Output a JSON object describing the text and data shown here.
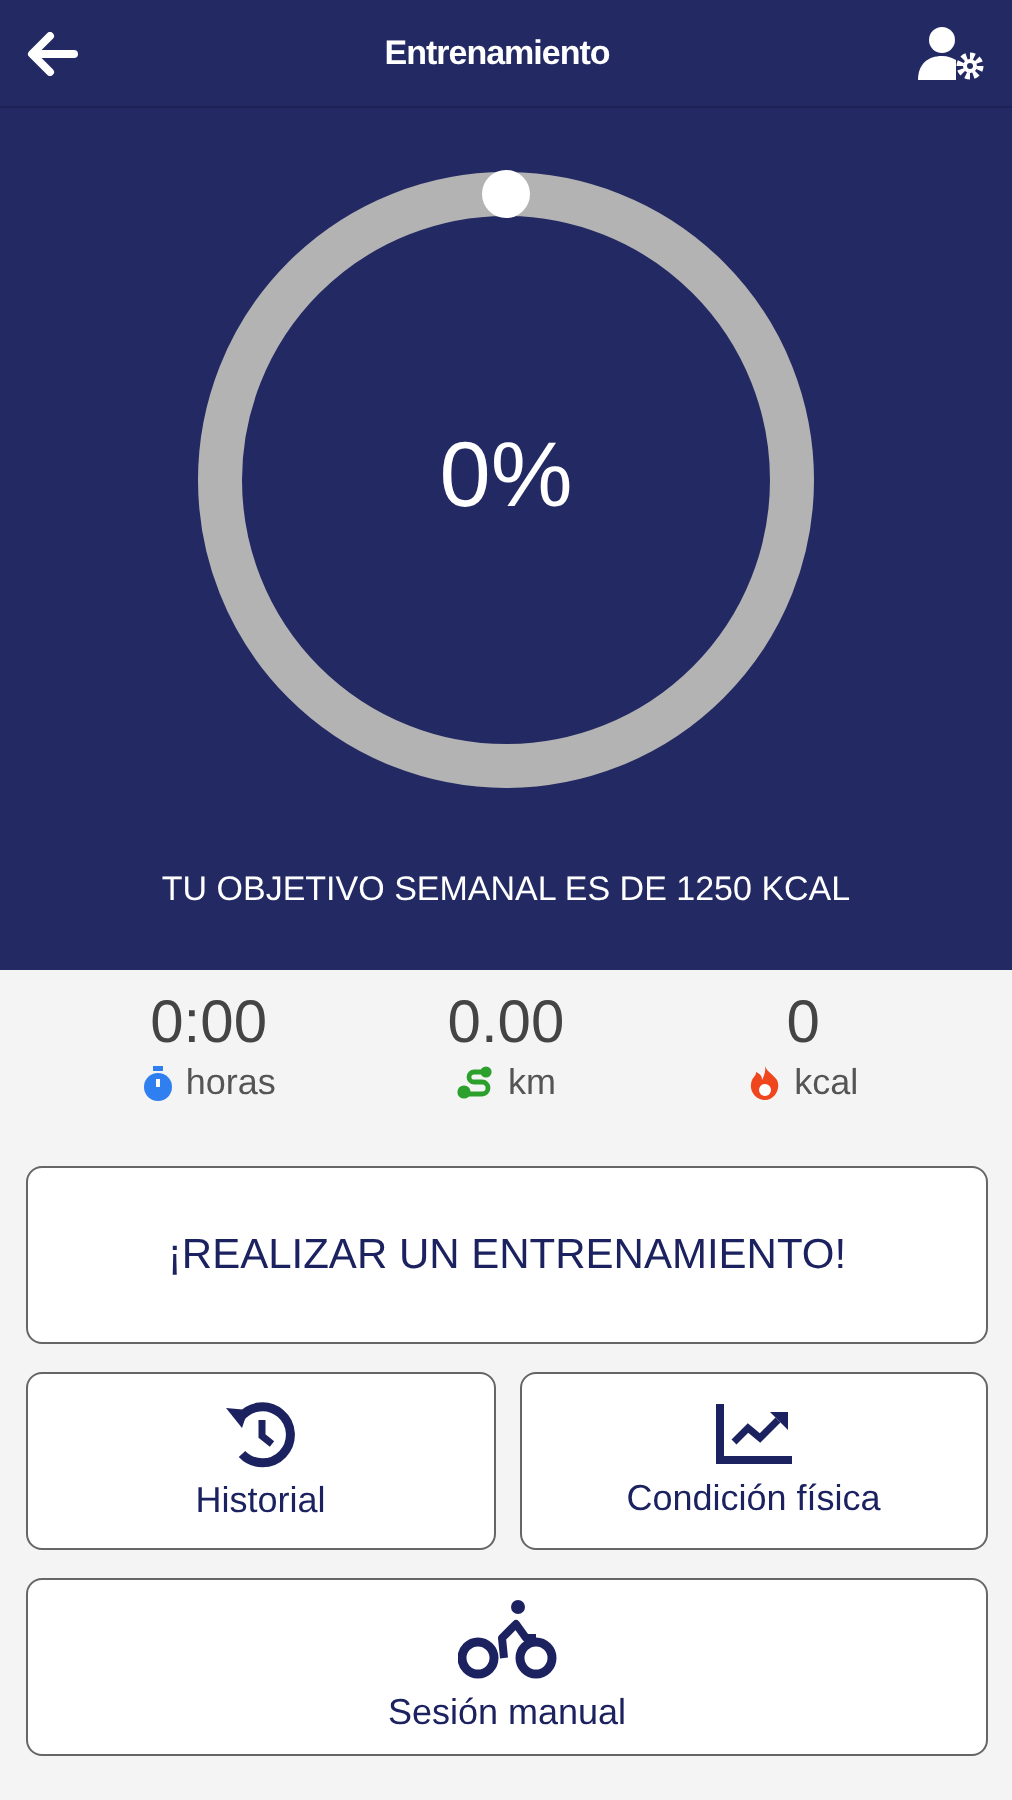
{
  "header": {
    "title": "Entrenamiento"
  },
  "progress": {
    "level": 0,
    "percent": "0%",
    "goal": "TU OBJETIVO SEMANAL ES DE 1250 KCAL"
  },
  "stats": [
    {
      "kind": "time",
      "value": "0:00",
      "unit": "horas",
      "color": "#2f7ff0"
    },
    {
      "kind": "distance",
      "value": "0.00",
      "unit": "km",
      "color": "#2ca02c"
    },
    {
      "kind": "energy",
      "value": "0",
      "unit": "kcal",
      "color": "#f0461e"
    }
  ],
  "main_button": "¡REALIZAR UN ENTRENAMIENTO!",
  "tiles": [
    {
      "kind": "history",
      "label": "Historial"
    },
    {
      "kind": "chart",
      "label": "Condición física"
    },
    {
      "kind": "bike",
      "label": "Sesión manual"
    }
  ]
}
